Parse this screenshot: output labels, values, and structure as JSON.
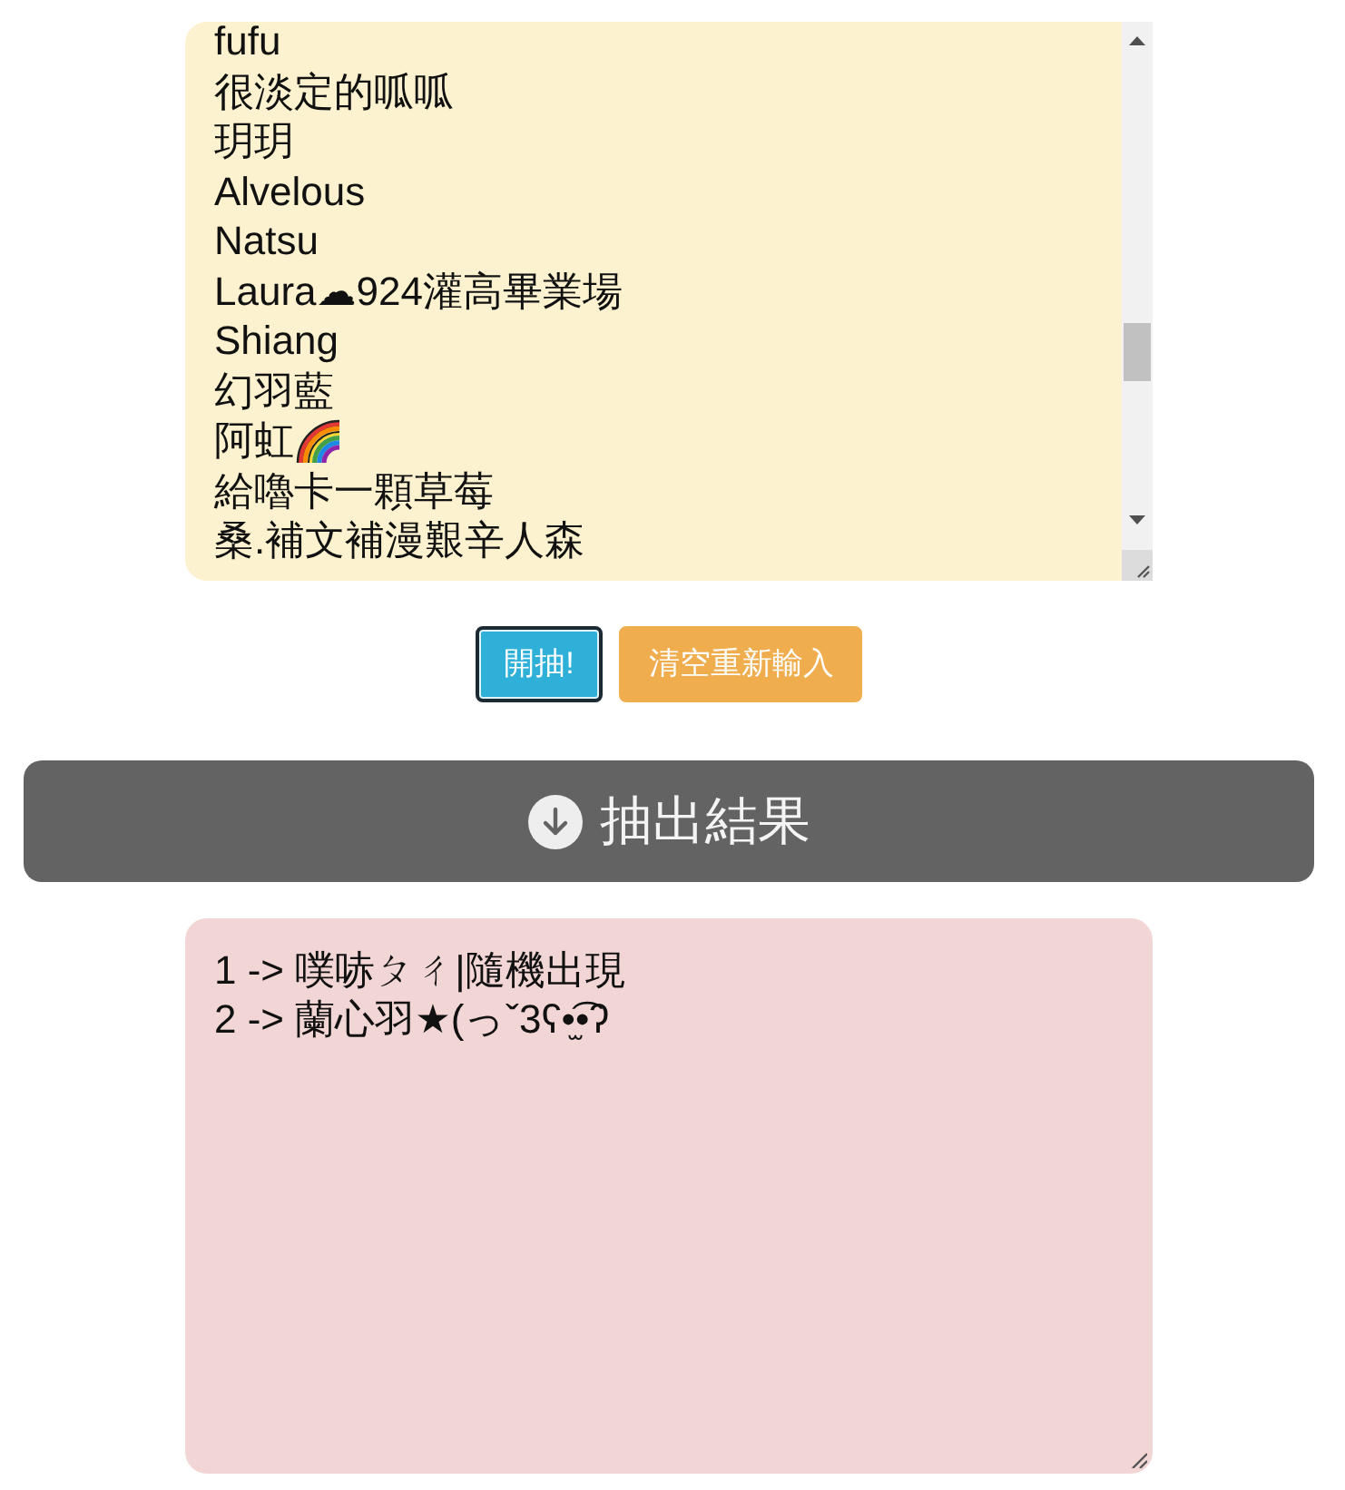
{
  "name_list": {
    "lines": [
      {
        "text": "fufu",
        "kind": "plain"
      },
      {
        "text": "很淡定的呱呱",
        "kind": "plain"
      },
      {
        "text": "玥玥",
        "kind": "plain"
      },
      {
        "text": "Alvelous",
        "kind": "plain"
      },
      {
        "text": "Natsu",
        "kind": "plain"
      },
      {
        "text": "Laura☁924灌高畢業場",
        "kind": "plain"
      },
      {
        "text": "Shiang",
        "kind": "plain"
      },
      {
        "text": "幻羽藍",
        "kind": "plain"
      },
      {
        "text": "阿虹",
        "kind": "with_icon"
      },
      {
        "text": "給嚕卡一顆草莓",
        "kind": "plain"
      },
      {
        "text": "桑.補文補漫艱辛人森",
        "kind": "plain"
      }
    ]
  },
  "buttons": [
    {
      "label": "開抽!",
      "kind": "primary",
      "focused": true
    },
    {
      "label": "清空重新輸入",
      "kind": "warning",
      "focused": false
    }
  ],
  "results_header": {
    "title": "抽出結果"
  },
  "results": {
    "lines": [
      "1 -> 噗哧ㄆㄔ|隨機出現",
      "2 -> 蘭心羽★(っˇ3ʕ•̫͡•ʔ"
    ]
  }
}
